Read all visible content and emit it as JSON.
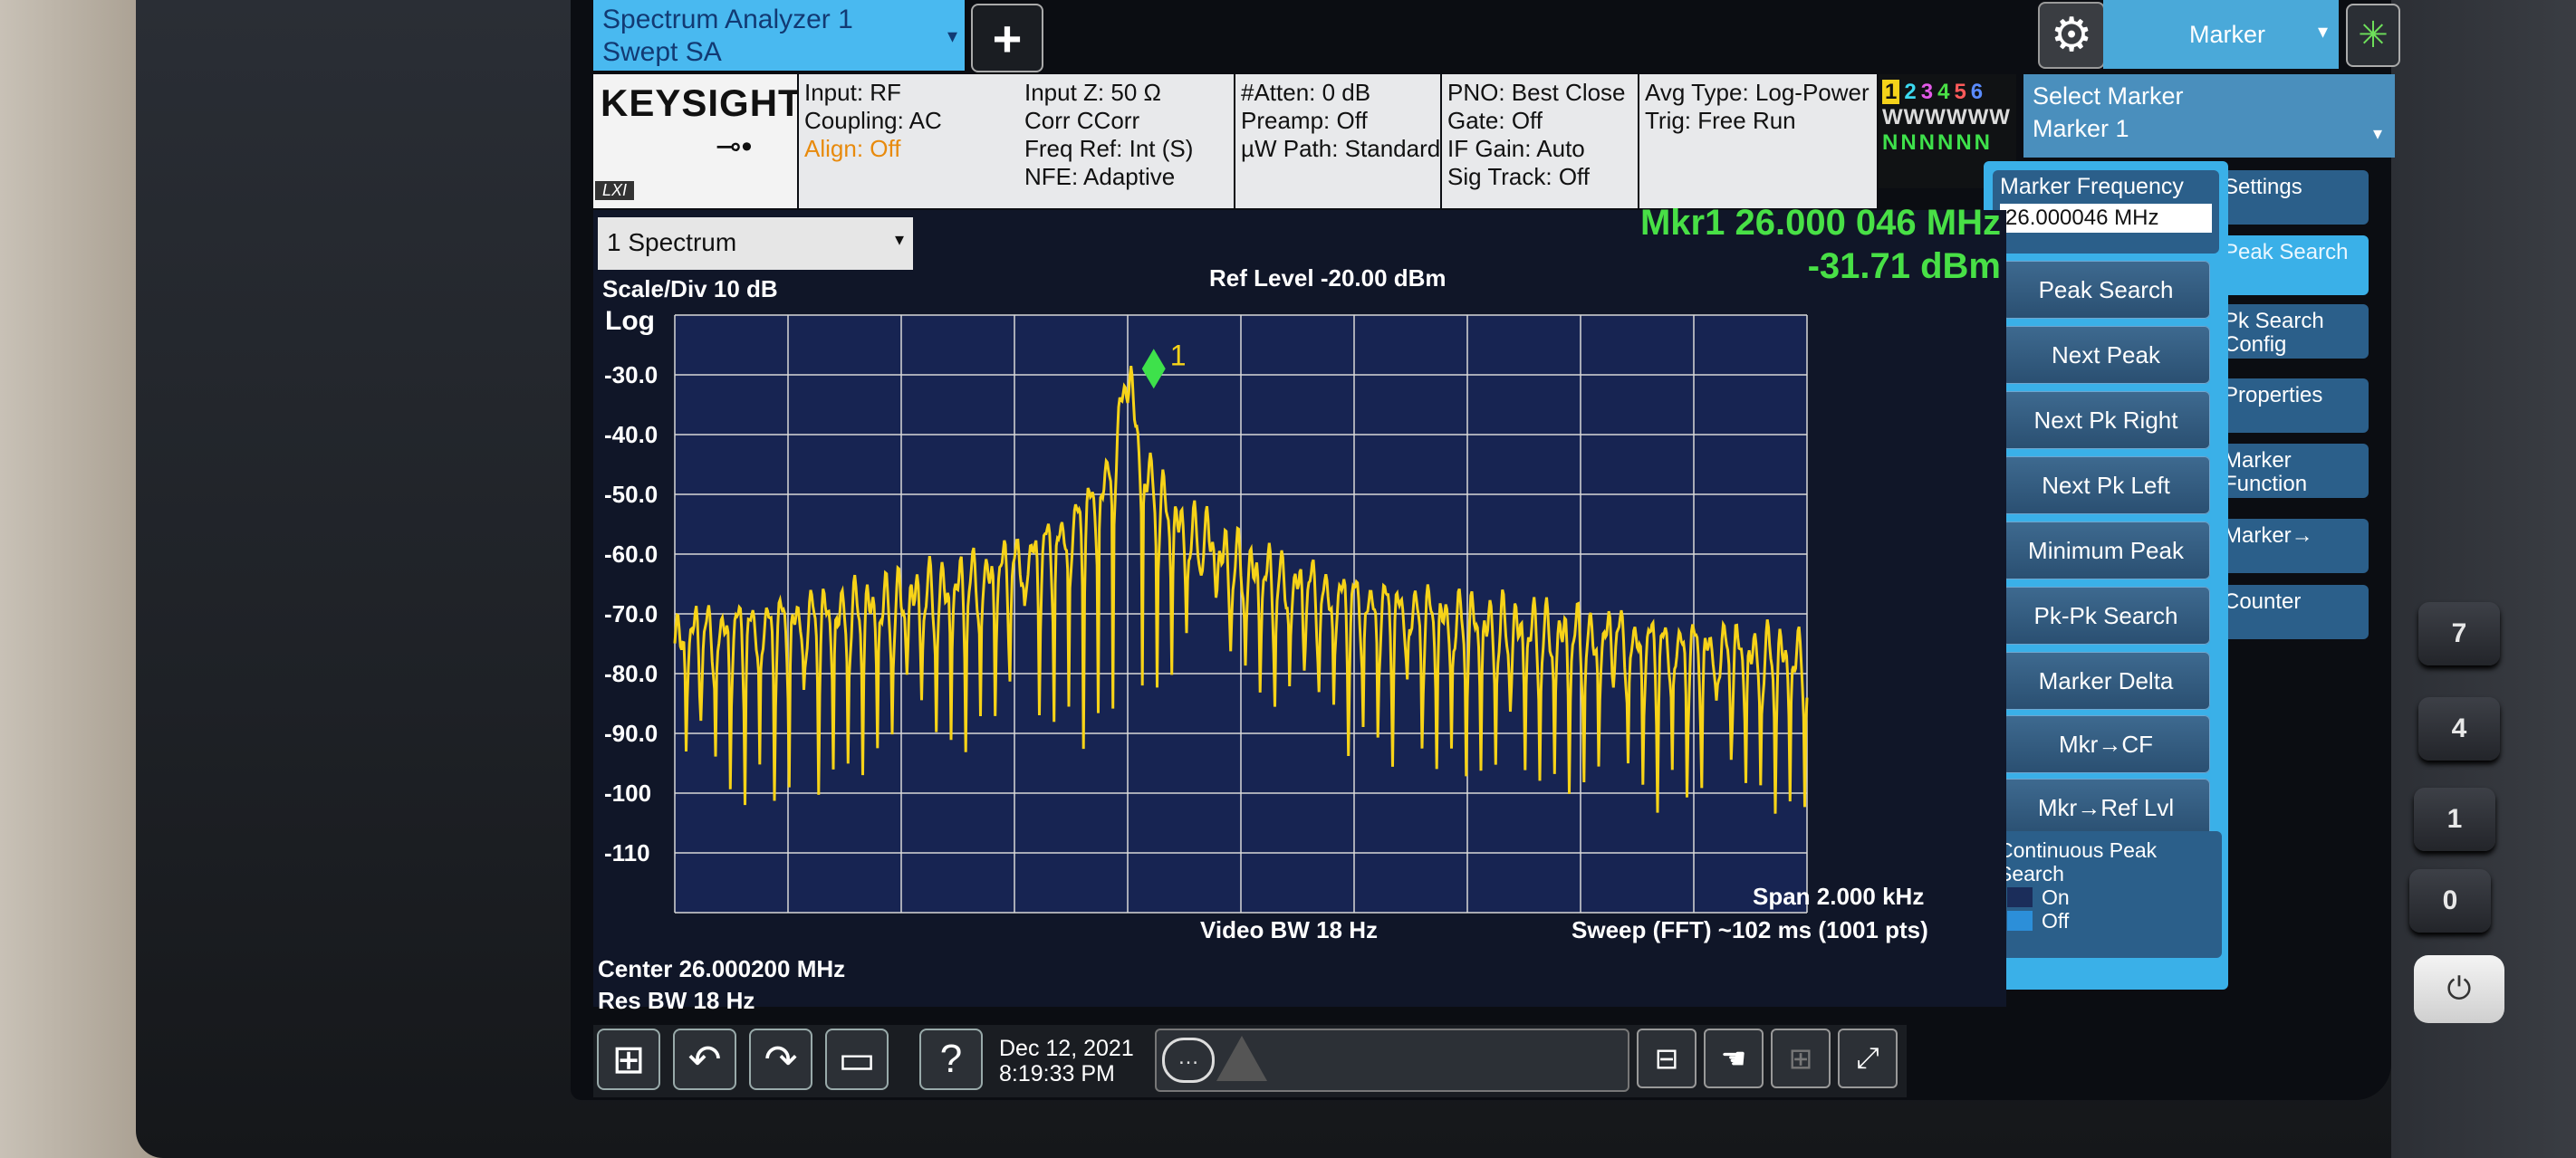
{
  "top": {
    "mode_title": "Spectrum Analyzer 1",
    "mode_sub": "Swept SA",
    "add": "+",
    "gear": "⚙",
    "menu": "Marker",
    "busy": "✳",
    "caret": "▾"
  },
  "logo": {
    "brand": "KEYSIGHT",
    "lxi": "LXI",
    "conn": "⊸•"
  },
  "header": {
    "col1": [
      "Input: RF",
      "Coupling: AC",
      "Align: Off"
    ],
    "col2": [
      "Input Z: 50 Ω",
      "Corr CCorr",
      "Freq Ref: Int (S)",
      "NFE: Adaptive"
    ],
    "col3": [
      "#Atten: 0 dB",
      "Preamp: Off",
      "µW Path: Standard"
    ],
    "col4": [
      "PNO: Best Close",
      "Gate: Off",
      "IF Gain: Auto",
      "Sig Track: Off"
    ],
    "col5": [
      "Avg Type: Log-Power",
      "Trig: Free Run"
    ],
    "traces": {
      "n1": "1",
      "n2": "2",
      "n3": "3",
      "n4": "4",
      "n5": "5",
      "n6": "6",
      "row2": "WWWWWW",
      "row3": "NNNNNN"
    },
    "trace_colors": [
      "#f5d21a",
      "#3bd9f0",
      "#e35ae8",
      "#4ae046",
      "#ff5a5a",
      "#5a8bff"
    ]
  },
  "select_marker": {
    "title": "Select Marker",
    "value": "Marker 1"
  },
  "softkeys": {
    "marker_frequency_label": "Marker Frequency",
    "marker_frequency_value": "26.000046 MHz",
    "buttons": [
      "Peak Search",
      "Next Peak",
      "Next Pk Right",
      "Next Pk Left",
      "Minimum Peak",
      "Pk-Pk Search",
      "Marker Delta",
      "Mkr→CF",
      "Mkr→Ref Lvl"
    ],
    "continuous_label": "Continuous Peak Search",
    "on": "On",
    "off": "Off"
  },
  "menu_tabs": [
    "Settings",
    "Peak Search",
    "Pk Search Config",
    "Properties",
    "Marker Function",
    "Marker→",
    "Counter"
  ],
  "graph": {
    "view_name": "1 Spectrum",
    "scale": "Scale/Div 10 dB",
    "scale_type": "Log",
    "ref_level": "Ref Level -20.00 dBm",
    "marker_line1": "Mkr1  26.000 046 MHz",
    "marker_line2": "-31.71 dBm",
    "marker_tag": "1",
    "y_ticks": [
      "-30.0",
      "-40.0",
      "-50.0",
      "-60.0",
      "-70.0",
      "-80.0",
      "-90.0",
      "-100",
      "-110"
    ],
    "center": "Center 26.000200 MHz",
    "res_bw": "Res BW 18 Hz",
    "video_bw": "Video BW 18 Hz",
    "span": "Span 2.000 kHz",
    "sweep": "Sweep (FFT) ~102 ms  (1001 pts)"
  },
  "status": {
    "date": "Dec 12, 2021",
    "time": "8:19:33 PM",
    "help": "?",
    "undo": "↶",
    "redo": "↷"
  },
  "keypad": [
    "7",
    "4",
    "1",
    "0"
  ],
  "chart_data": {
    "type": "line",
    "xlabel": "",
    "ylabel": "",
    "ylim": [
      -120,
      -20
    ],
    "xlim_hz": [
      25999200,
      26001200
    ],
    "marker": {
      "x_mhz": 26.000046,
      "y_dbm": -31.71
    },
    "peaks": {
      "x_mhz": [
        25.99924,
        25.99943,
        25.99962,
        25.99981,
        26.0,
        26.00014,
        26.00032,
        26.0005,
        26.00068,
        26.00086,
        26.00105
      ],
      "y_dbm": [
        -84,
        -86,
        -78,
        -71,
        -31.7,
        -61,
        -76,
        -84,
        -86,
        -79,
        -86
      ]
    },
    "series": [
      {
        "name": "Trace 1",
        "color": "#f5d21a"
      }
    ]
  }
}
